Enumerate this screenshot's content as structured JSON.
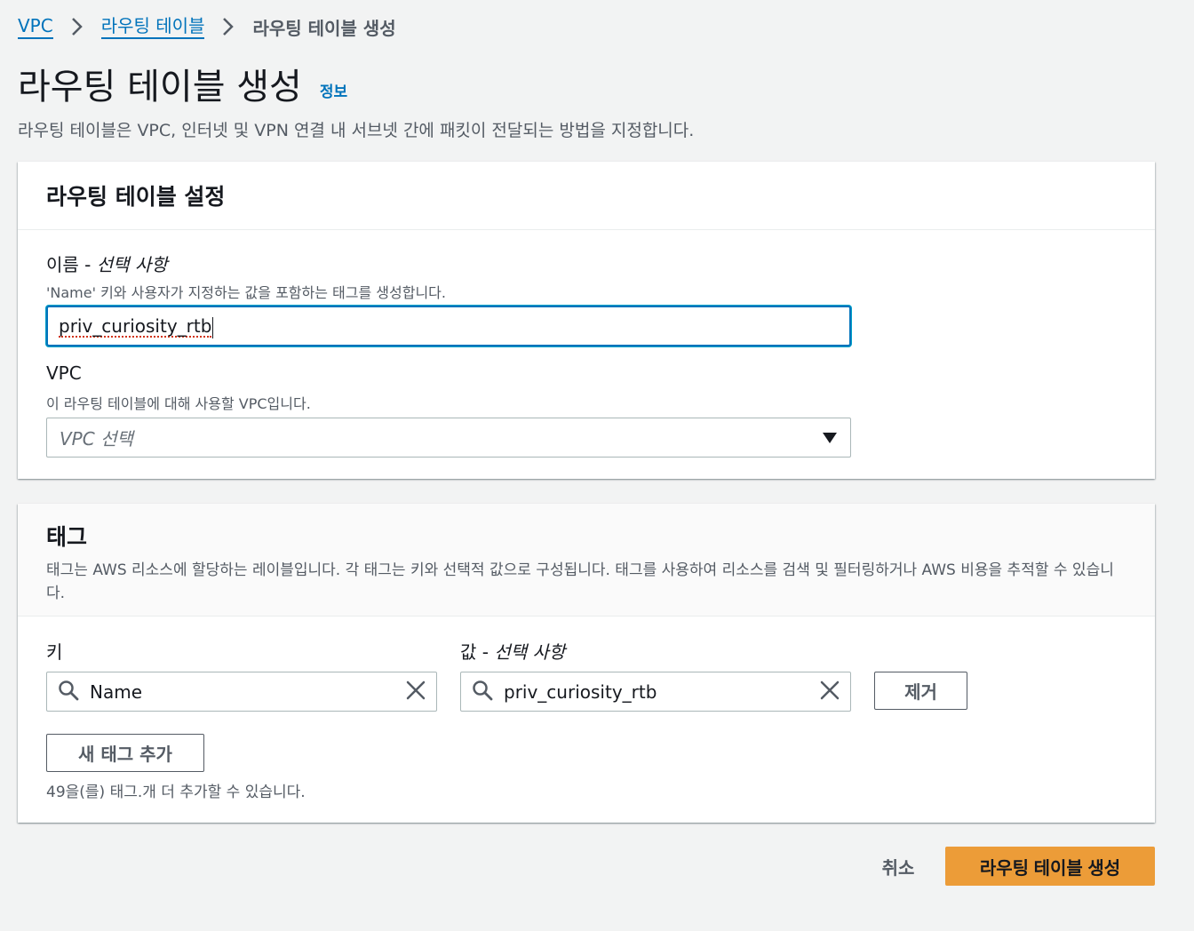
{
  "breadcrumb": {
    "items": [
      {
        "label": "VPC"
      },
      {
        "label": "라우팅 테이블"
      }
    ],
    "current": "라우팅 테이블 생성"
  },
  "page": {
    "title": "라우팅 테이블 생성",
    "info_link": "정보",
    "description": "라우팅 테이블은 VPC, 인터넷 및 VPN 연결 내 서브넷 간에 패킷이 전달되는 방법을 지정합니다."
  },
  "settings": {
    "title": "라우팅 테이블 설정",
    "name": {
      "label": "이름 - ",
      "optional": "선택 사항",
      "description": "'Name' 키와 사용자가 지정하는 값을 포함하는 태그를 생성합니다.",
      "value": "priv_curiosity_rtb"
    },
    "vpc": {
      "label": "VPC",
      "description": "이 라우팅 테이블에 대해 사용할 VPC입니다.",
      "placeholder": "VPC 선택"
    }
  },
  "tags": {
    "title": "태그",
    "description": "태그는 AWS 리소스에 할당하는 레이블입니다. 각 태그는 키와 선택적 값으로 구성됩니다. 태그를 사용하여 리소스를 검색 및 필터링하거나 AWS 비용을 추적할 수 있습니다.",
    "key_label": "키",
    "value_label": "값 - ",
    "value_optional": "선택 사항",
    "rows": [
      {
        "key": "Name",
        "value": "priv_curiosity_rtb"
      }
    ],
    "remove_label": "제거",
    "add_label": "새 태그 추가",
    "limit_text": "49을(를) 태그.개 더 추가할 수 있습니다."
  },
  "footer": {
    "cancel_label": "취소",
    "create_label": "라우팅 테이블 생성"
  },
  "colors": {
    "accent": "#0073bb",
    "primary_button": "#ec9c38",
    "background": "#f2f3f3"
  },
  "icons": {
    "breadcrumb_separator": "chevron-right-icon",
    "info": "info-link",
    "dropdown": "caret-down-icon",
    "search": "search-icon",
    "clear": "clear-icon"
  }
}
